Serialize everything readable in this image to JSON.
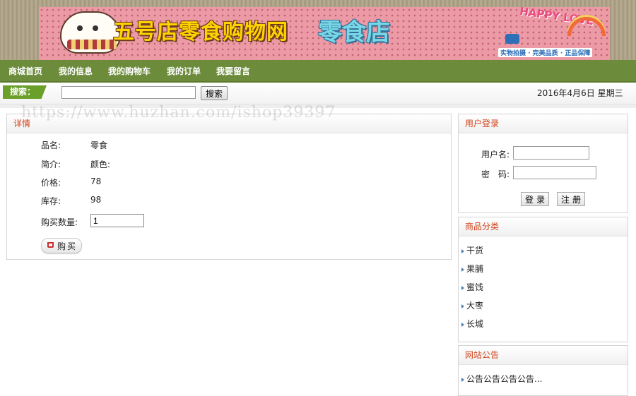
{
  "banner": {
    "title": "五号店零食购物网",
    "big_title": "零食店",
    "happy": "HAPPY LOVE",
    "subtitle": "实物拍摄 · 完美品质 · 正品保障"
  },
  "nav": {
    "items": [
      "商城首页",
      "我的信息",
      "我的购物车",
      "我的订单",
      "我要留言"
    ]
  },
  "search": {
    "label": "搜索：",
    "value": "",
    "button": "搜索"
  },
  "date": "2016年4月6日 星期三",
  "watermark": "https://www.huzhan.com/ishop39397",
  "detail": {
    "title": "详情",
    "name_label": "品名:",
    "name_value": "零食",
    "intro_label": "简介:",
    "intro_value": "颜色:",
    "price_label": "价格:",
    "price_value": "78",
    "stock_label": "库存:",
    "stock_value": "98",
    "qty_label": "购买数量:",
    "qty_value": "1",
    "buy_label": "购买"
  },
  "login": {
    "title": "用户登录",
    "username_label": "用户名:",
    "password_label": "密　码:",
    "login_button": "登录",
    "register_button": "注册"
  },
  "category": {
    "title": "商品分类",
    "items": [
      "干货",
      "果脯",
      "蜜饯",
      "大枣",
      "长城"
    ]
  },
  "notice": {
    "title": "网站公告",
    "items": [
      "公告公告公告公告..."
    ]
  },
  "colors": {
    "nav_bg": "#6c8c3c",
    "panel_title": "#d0421b",
    "search_tag": "#6a9f2a"
  }
}
